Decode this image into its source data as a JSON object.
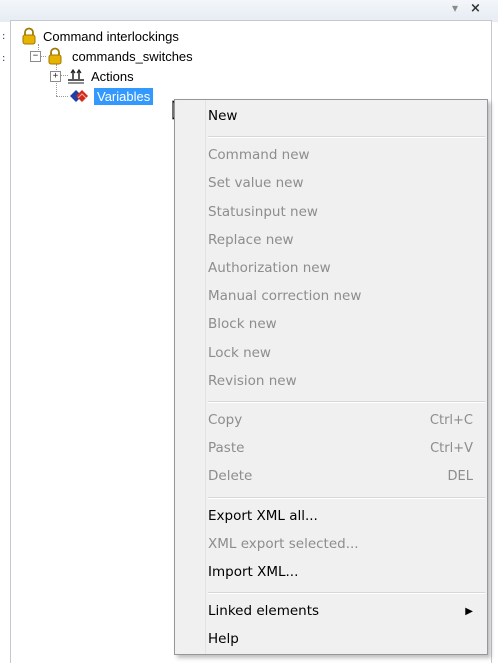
{
  "header": {
    "pin_label": "▾",
    "close_label": "×"
  },
  "tree": {
    "root": {
      "label": "Command interlockings",
      "icon": "lock-icon"
    },
    "child": {
      "label": "commands_switches",
      "expander": "−",
      "icon": "lock-icon"
    },
    "actions": {
      "label": "Actions",
      "expander": "+",
      "icon": "actions-icon"
    },
    "variables": {
      "label": "Variables",
      "icon": "variables-icon",
      "selected": true
    }
  },
  "context_menu": {
    "groups": [
      [
        {
          "label": "New",
          "enabled": true,
          "shortcut": ""
        }
      ],
      [
        {
          "label": "Command new",
          "enabled": false,
          "shortcut": ""
        },
        {
          "label": "Set value new",
          "enabled": false,
          "shortcut": ""
        },
        {
          "label": "Statusinput new",
          "enabled": false,
          "shortcut": ""
        },
        {
          "label": "Replace new",
          "enabled": false,
          "shortcut": ""
        },
        {
          "label": "Authorization new",
          "enabled": false,
          "shortcut": ""
        },
        {
          "label": "Manual correction new",
          "enabled": false,
          "shortcut": ""
        },
        {
          "label": "Block new",
          "enabled": false,
          "shortcut": ""
        },
        {
          "label": "Lock new",
          "enabled": false,
          "shortcut": ""
        },
        {
          "label": "Revision new",
          "enabled": false,
          "shortcut": ""
        }
      ],
      [
        {
          "label": "Copy",
          "enabled": false,
          "shortcut": "Ctrl+C"
        },
        {
          "label": "Paste",
          "enabled": false,
          "shortcut": "Ctrl+V"
        },
        {
          "label": "Delete",
          "enabled": false,
          "shortcut": "DEL"
        }
      ],
      [
        {
          "label": "Export XML all...",
          "enabled": true,
          "shortcut": ""
        },
        {
          "label": "XML export selected...",
          "enabled": false,
          "shortcut": ""
        },
        {
          "label": "Import XML...",
          "enabled": true,
          "shortcut": ""
        }
      ],
      [
        {
          "label": "Linked elements",
          "enabled": true,
          "shortcut": "",
          "submenu": true
        },
        {
          "label": "Help",
          "enabled": true,
          "shortcut": ""
        }
      ]
    ]
  },
  "colors": {
    "selection": "#3399ff",
    "menu_background": "#f0f0f0",
    "disabled_text": "#8d8d8d",
    "lock_gold": "#e8b200"
  }
}
